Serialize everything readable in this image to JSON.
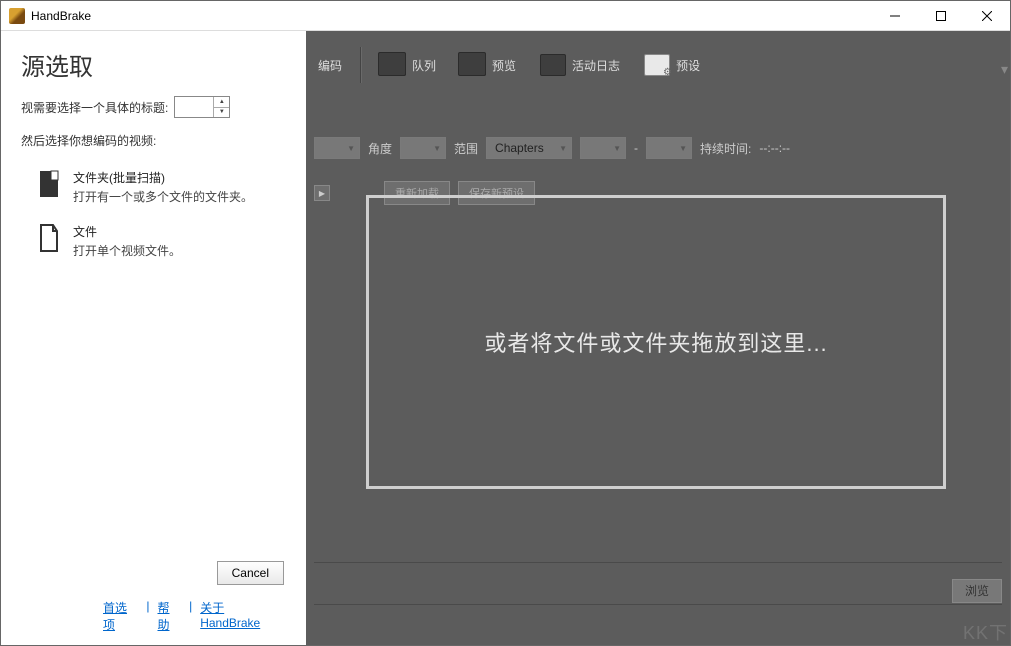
{
  "window": {
    "title": "HandBrake"
  },
  "source_panel": {
    "heading": "源选取",
    "title_prompt": "视需要选择一个具体的标题:",
    "encode_prompt": "然后选择你想编码的视频:",
    "opt_folder": {
      "title": "文件夹(批量扫描)",
      "desc": "打开有一个或多个文件的文件夹。"
    },
    "opt_file": {
      "title": "文件",
      "desc": "打开单个视频文件。"
    },
    "cancel": "Cancel",
    "links": {
      "prefs": "首选项",
      "help": "帮助",
      "about": "关于 HandBrake"
    }
  },
  "toolbar": {
    "encode": "编码",
    "queue": "队列",
    "preview": "预览",
    "activity": "活动日志",
    "preset": "预设"
  },
  "filters": {
    "angle": "角度",
    "range": "范围",
    "chapters": "Chapters",
    "dash": "-",
    "duration_lbl": "持续时间:",
    "duration_val": "--:--:--"
  },
  "preset_buttons": {
    "reload": "重新加载",
    "savenew": "保存新预设"
  },
  "drop_text": "或者将文件或文件夹拖放到这里...",
  "browse": "浏览",
  "watermark": "KK下"
}
